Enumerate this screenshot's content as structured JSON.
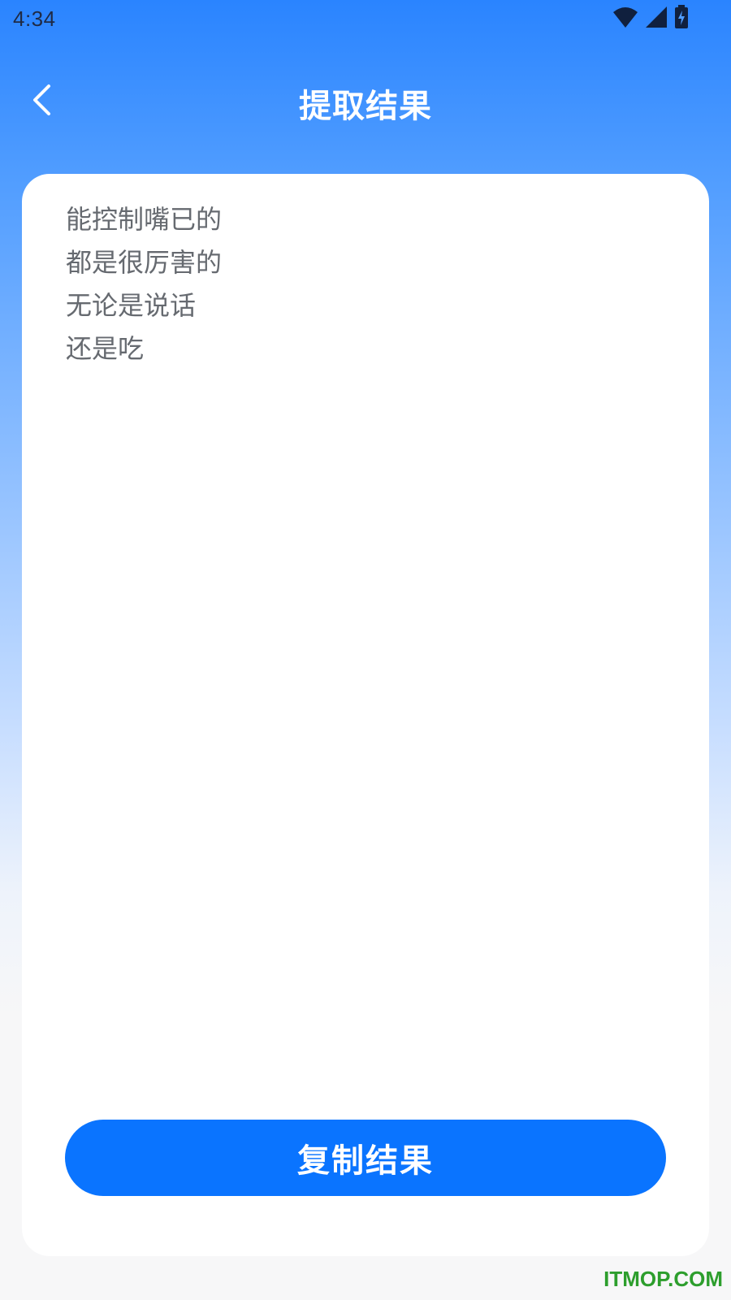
{
  "status_bar": {
    "time": "4:34",
    "icons": [
      "wifi-icon",
      "signal-icon",
      "battery-charging-icon"
    ]
  },
  "header": {
    "title": "提取结果",
    "back_icon": "chevron-left-icon"
  },
  "result": {
    "text": "能控制嘴已的\n都是很厉害的\n无论是说话\n还是吃"
  },
  "actions": {
    "copy_label": "复制结果"
  },
  "watermark": {
    "text": "ITMOP.COM"
  },
  "colors": {
    "primary": "#0a74ff",
    "header_gradient_top": "#2a84ff",
    "text_gray": "#666a70",
    "watermark_green": "#2d9e2d"
  }
}
